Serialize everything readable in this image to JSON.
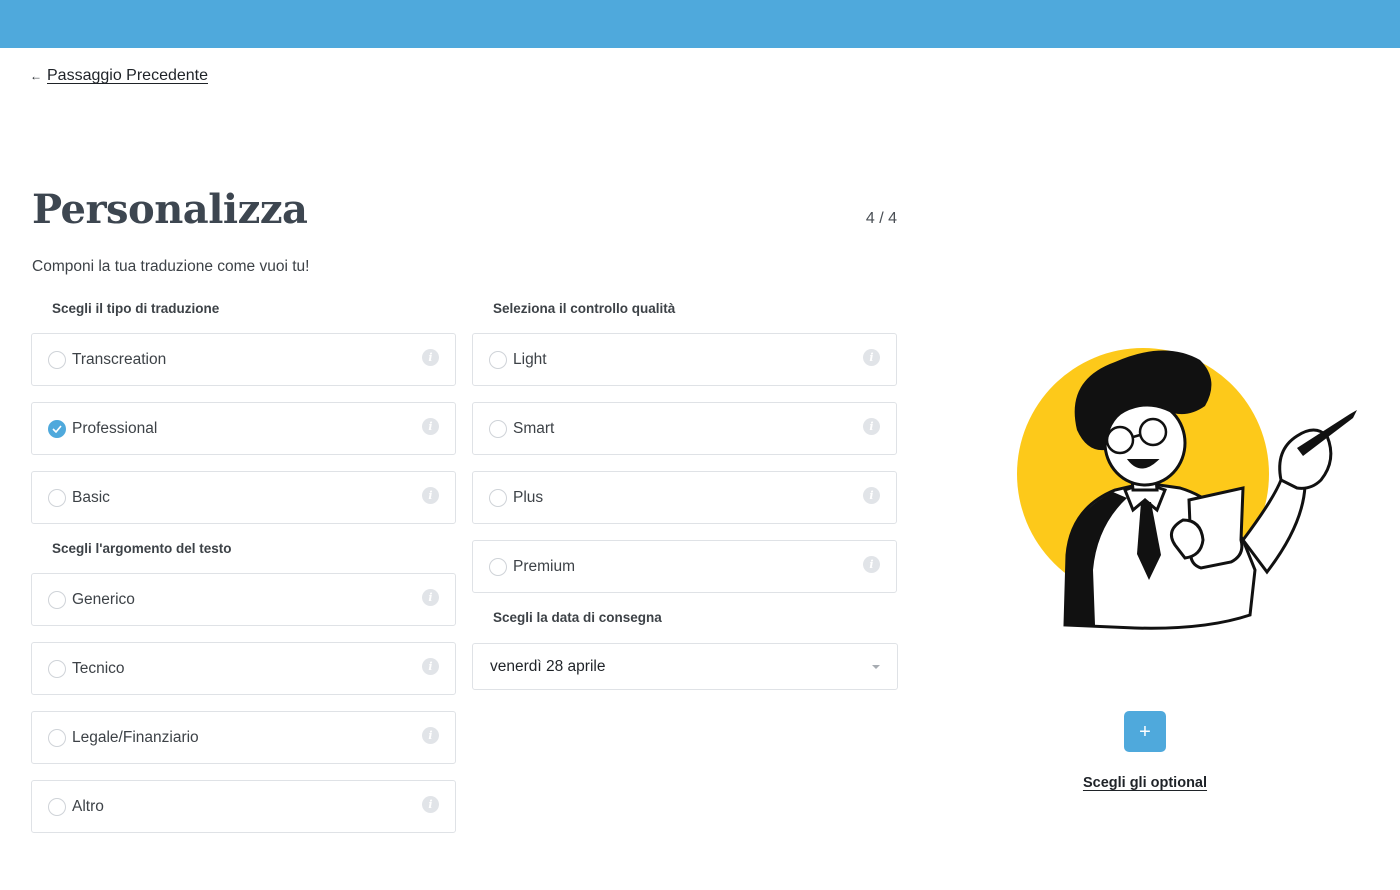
{
  "nav": {
    "back_arrow": "←",
    "back_label": "Passaggio Precedente"
  },
  "header": {
    "title": "Personalizza",
    "step": "4 / 4",
    "subtitle": "Componi la tua traduzione come vuoi tu!"
  },
  "translation_type": {
    "label": "Scegli il tipo di traduzione",
    "selected": "Professional",
    "options": [
      {
        "label": "Transcreation",
        "checked": false
      },
      {
        "label": "Professional",
        "checked": true
      },
      {
        "label": "Basic",
        "checked": false
      }
    ]
  },
  "text_topic": {
    "label": "Scegli l'argomento del testo",
    "options": [
      {
        "label": "Generico",
        "checked": false
      },
      {
        "label": "Tecnico",
        "checked": false
      },
      {
        "label": "Legale/Finanziario",
        "checked": false
      },
      {
        "label": "Altro",
        "checked": false
      }
    ]
  },
  "quality_control": {
    "label": "Seleziona il controllo qualità",
    "options": [
      {
        "label": "Light",
        "checked": false
      },
      {
        "label": "Smart",
        "checked": false
      },
      {
        "label": "Plus",
        "checked": false
      },
      {
        "label": "Premium",
        "checked": false
      }
    ]
  },
  "delivery": {
    "label": "Scegli la data di consegna",
    "value": "venerdì 28 aprile"
  },
  "optional": {
    "button": "+",
    "link": "Scegli gli optional"
  },
  "colors": {
    "accent": "#4fa9dc",
    "illustration_circle": "#fdc91a",
    "text": "#3d4247",
    "border": "#dfe2e6"
  },
  "icons": {
    "info": "i",
    "check": "check-icon"
  }
}
